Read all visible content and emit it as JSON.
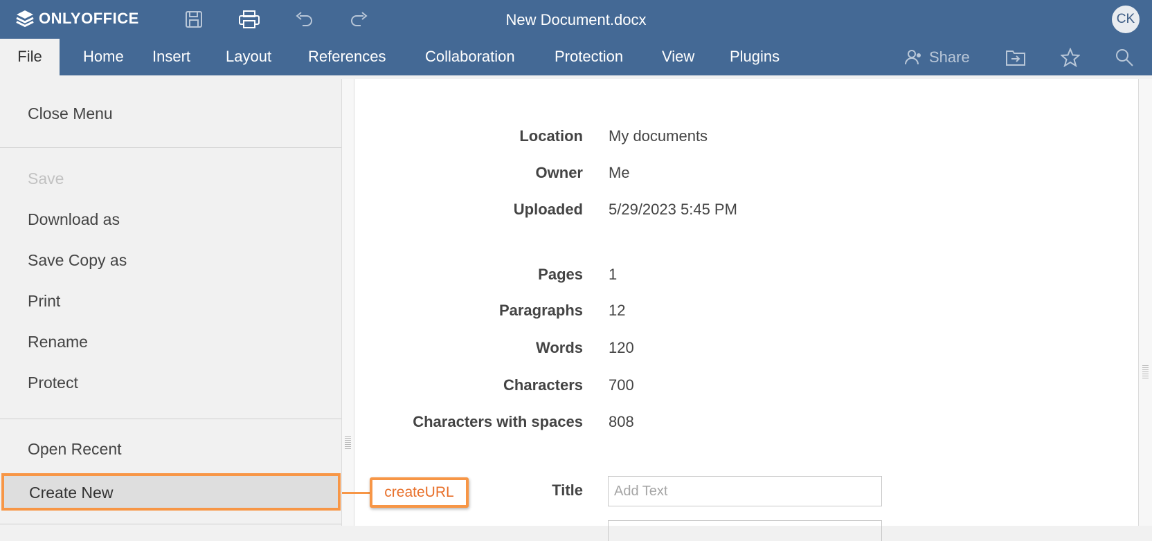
{
  "app": {
    "brand": "ONLYOFFICE",
    "document_title": "New Document.docx",
    "user_initials": "CK",
    "accent_color": "#446995"
  },
  "toolbar": {
    "save_icon": "save-icon",
    "print_icon": "print-icon",
    "undo_icon": "undo-icon",
    "redo_icon": "redo-icon"
  },
  "tabs": [
    {
      "label": "File",
      "active": true
    },
    {
      "label": "Home"
    },
    {
      "label": "Insert"
    },
    {
      "label": "Layout"
    },
    {
      "label": "References"
    },
    {
      "label": "Collaboration"
    },
    {
      "label": "Protection"
    },
    {
      "label": "View"
    },
    {
      "label": "Plugins"
    }
  ],
  "right_tools": {
    "share_label": "Share"
  },
  "file_menu": {
    "items": [
      {
        "label": "Close Menu"
      },
      {
        "label": "Save",
        "disabled": true
      },
      {
        "label": "Download as"
      },
      {
        "label": "Save Copy as"
      },
      {
        "label": "Print"
      },
      {
        "label": "Rename"
      },
      {
        "label": "Protect"
      },
      {
        "label": "Open Recent"
      },
      {
        "label": "Create New",
        "highlighted": true
      }
    ]
  },
  "annotation": {
    "callout_label": "createURL",
    "color": "#f79646"
  },
  "document_info": {
    "location_label": "Location",
    "location_value": "My documents",
    "owner_label": "Owner",
    "owner_value": "Me",
    "uploaded_label": "Uploaded",
    "uploaded_value": "5/29/2023 5:45 PM",
    "pages_label": "Pages",
    "pages_value": "1",
    "paragraphs_label": "Paragraphs",
    "paragraphs_value": "12",
    "words_label": "Words",
    "words_value": "120",
    "characters_label": "Characters",
    "characters_value": "700",
    "characters_spaces_label": "Characters with spaces",
    "characters_spaces_value": "808",
    "title_label": "Title",
    "title_placeholder": "Add Text"
  }
}
